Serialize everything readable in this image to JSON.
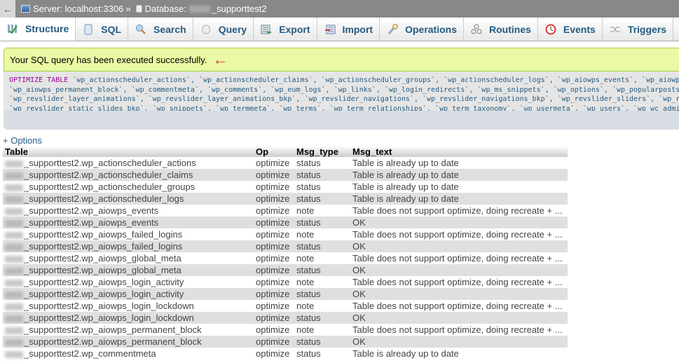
{
  "topbar": {
    "back_icon": "arrow-left",
    "server_icon": "server-icon",
    "server_label": "Server: localhost:3306",
    "separator": "»",
    "database_icon": "database-icon",
    "database_label": "Database:",
    "database_name": "_supporttest2"
  },
  "tabs": [
    {
      "label": "Structure",
      "icon": "structure-icon",
      "active": true
    },
    {
      "label": "SQL",
      "icon": "sql-scroll-icon"
    },
    {
      "label": "Search",
      "icon": "magnifier-icon"
    },
    {
      "label": "Query",
      "icon": "query-db-icon"
    },
    {
      "label": "Export",
      "icon": "export-icon"
    },
    {
      "label": "Import",
      "icon": "import-icon"
    },
    {
      "label": "Operations",
      "icon": "wrench-icon"
    },
    {
      "label": "Routines",
      "icon": "routines-gears-icon"
    },
    {
      "label": "Events",
      "icon": "clock-icon"
    },
    {
      "label": "Triggers",
      "icon": "triggers-icon"
    }
  ],
  "message": {
    "text": "Your SQL query has been executed successfully.",
    "annotation": "←"
  },
  "sql": {
    "keyword": "OPTIMIZE TABLE",
    "lines": [
      " `wp_actionscheduler_actions`, `wp_actionscheduler_claims`, `wp_actionscheduler_groups`, `wp_actionscheduler_logs`, `wp_aiowps_events`, `wp_aiowps_fa",
      "`wp_aiowps_permanent_block`, `wp_commentmeta`, `wp_comments`, `wp_eum_logs`, `wp_links`, `wp_login_redirects`, `wp_ms_snippets`, `wp_options`, `wp_popularpostsdata",
      "`wp_revslider_layer_animations`, `wp_revslider_layer_animations_bkp`, `wp_revslider_navigations`, `wp_revslider_navigations_bkp`, `wp_revslider_sliders`, `wp_revsl",
      "`wp_revslider_static_slides_bkp`, `wp_snippets`, `wp_termmeta`, `wp_terms`, `wp_term_relationships`, `wp_term_taxonomy`, `wp_usermeta`, `wp_users`, `wp_wc_admin_no"
    ]
  },
  "options_link": "+ Options",
  "results": {
    "headers": [
      "Table",
      "Op",
      "Msg_type",
      "Msg_text"
    ],
    "rows": [
      [
        "_supporttest2.wp_actionscheduler_actions",
        "optimize",
        "status",
        "Table is already up to date"
      ],
      [
        "_supporttest2.wp_actionscheduler_claims",
        "optimize",
        "status",
        "Table is already up to date"
      ],
      [
        "_supporttest2.wp_actionscheduler_groups",
        "optimize",
        "status",
        "Table is already up to date"
      ],
      [
        "_supporttest2.wp_actionscheduler_logs",
        "optimize",
        "status",
        "Table is already up to date"
      ],
      [
        "_supporttest2.wp_aiowps_events",
        "optimize",
        "note",
        "Table does not support optimize, doing recreate + ..."
      ],
      [
        "_supporttest2.wp_aiowps_events",
        "optimize",
        "status",
        "OK"
      ],
      [
        "_supporttest2.wp_aiowps_failed_logins",
        "optimize",
        "note",
        "Table does not support optimize, doing recreate + ..."
      ],
      [
        "_supporttest2.wp_aiowps_failed_logins",
        "optimize",
        "status",
        "OK"
      ],
      [
        "_supporttest2.wp_aiowps_global_meta",
        "optimize",
        "note",
        "Table does not support optimize, doing recreate + ..."
      ],
      [
        "_supporttest2.wp_aiowps_global_meta",
        "optimize",
        "status",
        "OK"
      ],
      [
        "_supporttest2.wp_aiowps_login_activity",
        "optimize",
        "note",
        "Table does not support optimize, doing recreate + ..."
      ],
      [
        "_supporttest2.wp_aiowps_login_activity",
        "optimize",
        "status",
        "OK"
      ],
      [
        "_supporttest2.wp_aiowps_login_lockdown",
        "optimize",
        "note",
        "Table does not support optimize, doing recreate + ..."
      ],
      [
        "_supporttest2.wp_aiowps_login_lockdown",
        "optimize",
        "status",
        "OK"
      ],
      [
        "_supporttest2.wp_aiowps_permanent_block",
        "optimize",
        "note",
        "Table does not support optimize, doing recreate + ..."
      ],
      [
        "_supporttest2.wp_aiowps_permanent_block",
        "optimize",
        "status",
        "OK"
      ],
      [
        "_supporttest2.wp_commentmeta",
        "optimize",
        "status",
        "Table is already up to date"
      ]
    ]
  },
  "colors": {
    "link": "#235a81",
    "success_bg": "#ebf8a4",
    "success_border": "#a2d246",
    "sql_keyword": "#990099",
    "annotation_arrow": "#e43b3b",
    "row_even": "#dfdfdf"
  }
}
